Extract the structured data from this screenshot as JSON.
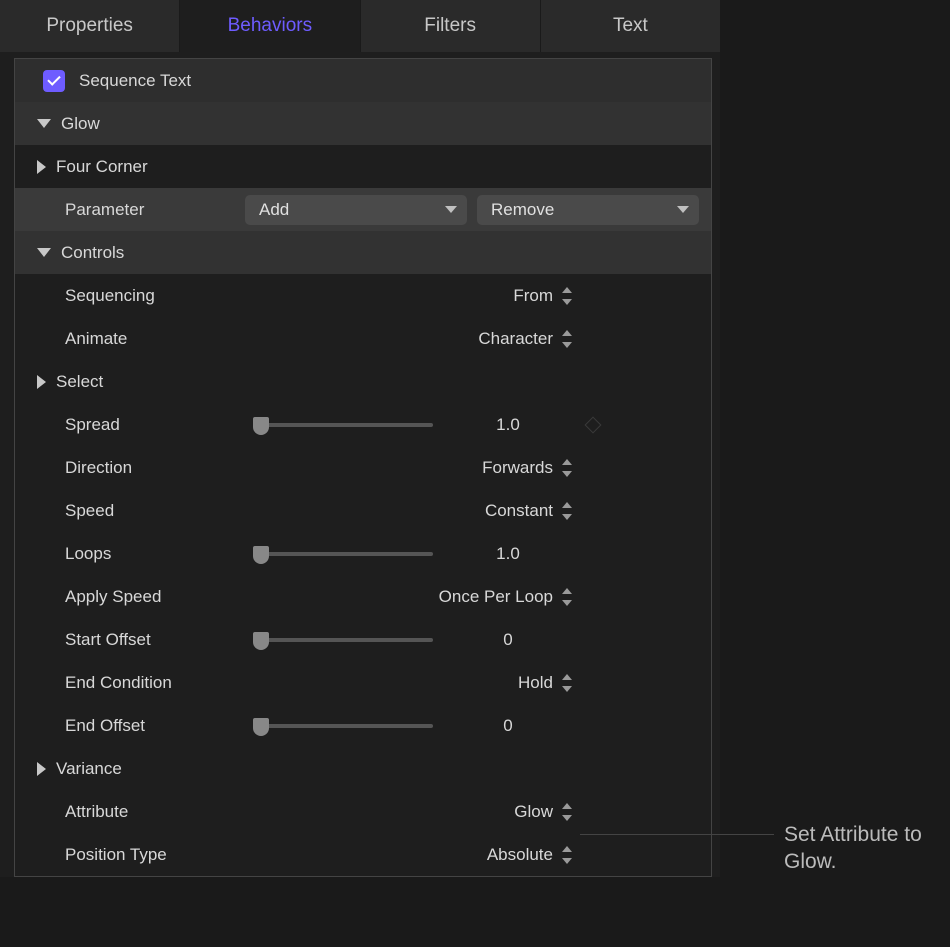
{
  "tabs": {
    "properties": "Properties",
    "behaviors": "Behaviors",
    "filters": "Filters",
    "text": "Text",
    "active": "behaviors"
  },
  "header": {
    "title": "Sequence Text",
    "checked": true
  },
  "groups": {
    "glow": {
      "label": "Glow",
      "expanded": true
    },
    "four_corner": {
      "label": "Four Corner",
      "expanded": false
    },
    "controls": {
      "label": "Controls",
      "expanded": true
    },
    "select": {
      "label": "Select",
      "expanded": false
    },
    "variance": {
      "label": "Variance",
      "expanded": false
    }
  },
  "parameter_row": {
    "label": "Parameter",
    "add": "Add",
    "remove": "Remove"
  },
  "controls": {
    "sequencing": {
      "label": "Sequencing",
      "value": "From"
    },
    "animate": {
      "label": "Animate",
      "value": "Character"
    },
    "spread": {
      "label": "Spread",
      "value": "1.0"
    },
    "direction": {
      "label": "Direction",
      "value": "Forwards"
    },
    "speed": {
      "label": "Speed",
      "value": "Constant"
    },
    "loops": {
      "label": "Loops",
      "value": "1.0"
    },
    "apply_speed": {
      "label": "Apply Speed",
      "value": "Once Per Loop"
    },
    "start_offset": {
      "label": "Start Offset",
      "value": "0"
    },
    "end_condition": {
      "label": "End Condition",
      "value": "Hold"
    },
    "end_offset": {
      "label": "End Offset",
      "value": "0"
    },
    "attribute": {
      "label": "Attribute",
      "value": "Glow"
    },
    "position_type": {
      "label": "Position Type",
      "value": "Absolute"
    }
  },
  "annotation": {
    "text": "Set Attribute to Glow."
  }
}
